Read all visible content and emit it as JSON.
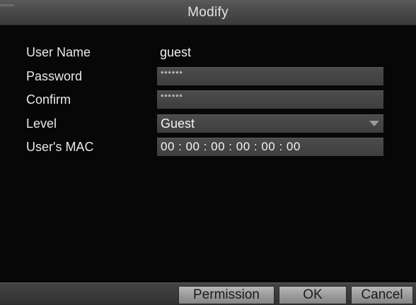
{
  "dialog": {
    "title": "Modify"
  },
  "form": {
    "user_name": {
      "label": "User Name",
      "value": "guest"
    },
    "password": {
      "label": "Password",
      "value": "******"
    },
    "confirm": {
      "label": "Confirm",
      "value": "******"
    },
    "level": {
      "label": "Level",
      "value": "Guest"
    },
    "mac": {
      "label": "User's MAC",
      "value": "00 : 00 : 00 : 00 : 00 : 00"
    }
  },
  "buttons": {
    "permission": "Permission",
    "ok": "OK",
    "cancel": "Cancel"
  },
  "icons": {
    "level_dropdown": "chevron-down-icon"
  }
}
